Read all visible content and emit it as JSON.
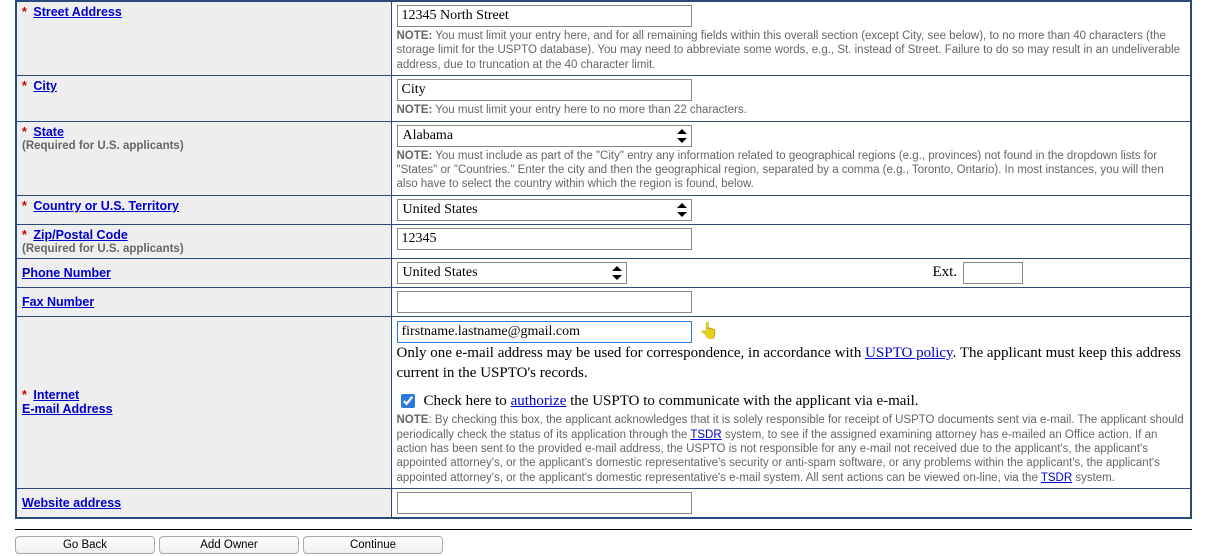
{
  "rows": {
    "street": {
      "label": "Street Address",
      "value": "12345 North Street",
      "note_prefix": "NOTE:",
      "note": "You must limit your entry here, and for all remaining fields within this overall section (except City, see below), to no more than 40 characters (the storage limit for the USPTO database). You may need to abbreviate some words, e.g., St. instead of Street. Failure to do so may result in an undeliverable address, due to truncation at the 40 character limit."
    },
    "city": {
      "label": "City",
      "value": "City",
      "note_prefix": "NOTE:",
      "note": "You must limit your entry here to no more than 22 characters."
    },
    "state": {
      "label": "State",
      "sub": "(Required for U.S. applicants)",
      "value": "Alabama",
      "note_prefix": "NOTE:",
      "note": "You must include as part of the \"City\" entry any information related to geographical regions (e.g., provinces) not found in the dropdown lists for \"States\" or \"Countries.\" Enter the city and then the geographical region, separated by a comma (e.g., Toronto, Ontario). In most instances, you will then also have to select the country within which the region is found, below."
    },
    "country": {
      "label": "Country or U.S. Territory",
      "value": "United States"
    },
    "zip": {
      "label": "Zip/Postal Code",
      "sub": "(Required for U.S. applicants)",
      "value": "12345"
    },
    "phone": {
      "label": "Phone Number",
      "value": "United States",
      "ext_label": "Ext.",
      "ext_value": ""
    },
    "fax": {
      "label": "Fax Number",
      "value": ""
    },
    "email": {
      "label_line1": "Internet",
      "label_line2": "E-mail Address",
      "value": "firstname.lastname@gmail.com",
      "help_before": "Only one e-mail address may be used for correspondence, in accordance with ",
      "help_link": "USPTO policy",
      "help_after": ". The applicant must keep this address current in the USPTO's records.",
      "check_prefix": "Check here to ",
      "check_link": "authorize",
      "check_suffix": " the USPTO to communicate with the applicant via e-mail.",
      "note_bold": "NOTE",
      "note_p1": ": By checking this box, the applicant acknowledges that it is solely responsible for receipt of USPTO documents sent via e-mail. The applicant should periodically check the status of its application through the ",
      "note_link1": "TSDR",
      "note_p2": " system, to see if the assigned examining attorney has e-mailed an Office action. If an action has been sent to the provided e-mail address, the USPTO is not responsible for any e-mail not received due to the applicant's, the applicant's appointed attorney's, or the applicant's domestic representative's security or anti-spam software, or any problems within the applicant's, the applicant's appointed attorney's, or the applicant's domestic representative's e-mail system. All sent actions can be viewed on-line, via the ",
      "note_link2": "TSDR",
      "note_p3": " system."
    },
    "website": {
      "label": "Website address",
      "value": ""
    }
  },
  "buttons": {
    "back": "Go Back",
    "add": "Add Owner",
    "continue": "Continue"
  }
}
